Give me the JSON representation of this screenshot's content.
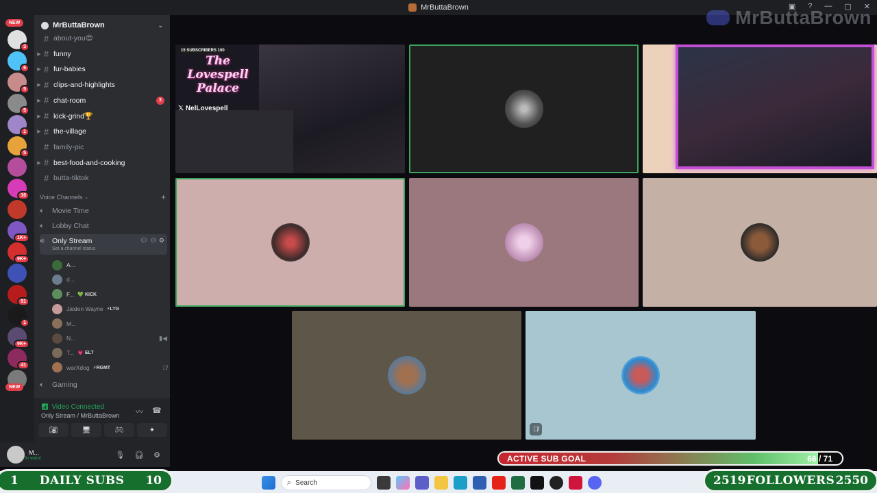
{
  "window": {
    "title": "MrButtaBrown",
    "watermark": "MrButtaBrown"
  },
  "servers": [
    {
      "badge": "3",
      "color": "#e0e0e0",
      "top": 0
    },
    {
      "badge": "6",
      "color": "#4fc3f7"
    },
    {
      "badge": "5",
      "color": "#c78b8b"
    },
    {
      "badge": "5",
      "color": "#8a8a8a"
    },
    {
      "badge": "1",
      "color": "#9e86c8"
    },
    {
      "badge": "5",
      "color": "#e7a33a"
    },
    {
      "badge": "",
      "color": "#b44e9c"
    },
    {
      "badge": "16",
      "color": "#d63cb8"
    },
    {
      "badge": "",
      "color": "#c0392b"
    },
    {
      "badge": "1K+",
      "color": "#7e57c2"
    },
    {
      "badge": "9K+",
      "color": "#d32f2f"
    },
    {
      "badge": "",
      "color": "#3f51b5"
    },
    {
      "badge": "51",
      "color": "#b71c1c"
    },
    {
      "badge": "1",
      "color": "#1a1a1a"
    },
    {
      "badge": "9K+",
      "color": "#5b4a72"
    },
    {
      "badge": "41",
      "color": "#8e2b5e"
    },
    {
      "badge": "",
      "color": "#7a7a7a"
    }
  ],
  "new_pill": "NEW",
  "guild": {
    "name": "MrButtaBrown"
  },
  "text_channels": [
    {
      "name": "about-you😍",
      "bright": false,
      "count": ""
    },
    {
      "name": "funny",
      "bright": true,
      "count": ""
    },
    {
      "name": "fur-babies",
      "bright": true,
      "count": ""
    },
    {
      "name": "clips-and-highlights",
      "bright": true,
      "count": ""
    },
    {
      "name": "chat-room",
      "bright": true,
      "count": "3"
    },
    {
      "name": "kick-grind🏆",
      "bright": true,
      "count": ""
    },
    {
      "name": "the-village",
      "bright": true,
      "count": ""
    },
    {
      "name": "family-pic",
      "bright": false,
      "count": ""
    },
    {
      "name": "best-food-and-cooking",
      "bright": true,
      "count": ""
    },
    {
      "name": "butta-tiktok",
      "bright": false,
      "count": ""
    }
  ],
  "voice_category": "Voice Channels",
  "voice_channels": {
    "movie": "Movie Time",
    "lobby": "Lobby Chat",
    "only": "Only Stream",
    "only_status": "Set a channel status",
    "gaming": "Gaming"
  },
  "members": [
    {
      "name": "A...",
      "tag": "",
      "color": "#3b6b3b",
      "bold": true
    },
    {
      "name": "d...",
      "tag": "",
      "color": "#6b7c8f",
      "bold": false
    },
    {
      "name": "F...",
      "tag": "💚 KICK",
      "color": "#5d8f5d",
      "bold": true
    },
    {
      "name": "Jaiden Wayne",
      "tag": "⚡LTG",
      "color": "#c49a9a",
      "bold": false
    },
    {
      "name": "M...",
      "tag": "",
      "color": "#8a6f5a",
      "bold": false
    },
    {
      "name": "N...",
      "tag": "",
      "color": "#5a4a3f",
      "bold": false,
      "right": "▮◀"
    },
    {
      "name": "T...",
      "tag": "💗 ELT",
      "color": "#7a6a5a",
      "bold": false
    },
    {
      "name": "warXdog",
      "tag": "⚡RGMT",
      "color": "#a07050",
      "bold": false,
      "right": "🎙̸"
    }
  ],
  "rtc": {
    "status": "Video Connected",
    "location": "Only Stream / MrButtaBrown"
  },
  "user": {
    "name": "M...",
    "status": "In voice"
  },
  "tiles": {
    "t1": {
      "subs": "15  SUBSCRIBERS  100",
      "logo_line1": "The Lovespell",
      "logo_line2": "Palace",
      "handle": "𝕏 NelLovespell"
    }
  },
  "sub_goal": {
    "label": "ACTIVE SUB GOAL",
    "value": "66 / 71",
    "current": 66,
    "target": 71
  },
  "daily_subs": {
    "current": "1",
    "label": "DAILY SUBS",
    "target": "10"
  },
  "followers": {
    "current": "2519",
    "label": "FOLLOWERS",
    "target": "2550"
  },
  "taskbar": {
    "search_placeholder": "Search"
  },
  "colors": {
    "tile_pink": "#ceadad",
    "tile_mauve": "#9b787d",
    "tile_beige": "#c4b0a4",
    "tile_olive": "#5e5648",
    "tile_blue": "#a7c6cf",
    "tile_dark": "#202020",
    "tile_peach": "#edd2bb"
  }
}
